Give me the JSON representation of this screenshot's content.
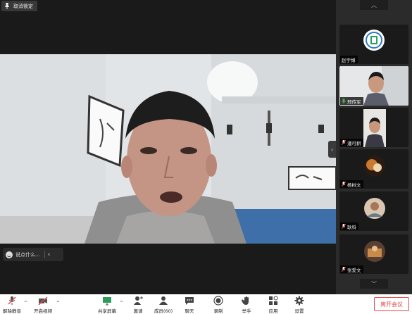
{
  "pin_badge": {
    "label": "取消锁定",
    "icon": "pin-icon"
  },
  "chat": {
    "placeholder": "说点什么...",
    "icon": "smiley-icon"
  },
  "participants": [
    {
      "name": "赵宇博",
      "mic": "none",
      "avatar": "logo"
    },
    {
      "name": "邢传军",
      "mic": "speaking",
      "active": true,
      "avatar": "video"
    },
    {
      "name": "潘可耕",
      "mic": "muted",
      "avatar": "video"
    },
    {
      "name": "杨树文",
      "mic": "muted",
      "avatar": "photo"
    },
    {
      "name": "耿科",
      "mic": "muted",
      "avatar": "photo"
    },
    {
      "name": "张爱文",
      "mic": "muted",
      "avatar": "photo"
    }
  ],
  "toolbar": {
    "unmute": "解除静音",
    "start_video": "开启视频",
    "share_screen": "共享屏幕",
    "invite": "邀请",
    "members": "成员(60)",
    "chat": "聊天",
    "record": "录制",
    "raise_hand": "举手",
    "apps": "应用",
    "settings": "设置",
    "leave": "离开会议"
  },
  "colors": {
    "active_tile": "#4caf50",
    "leave": "#e24a4a",
    "muted": "#e24a4a",
    "speaking": "#4caf50"
  }
}
